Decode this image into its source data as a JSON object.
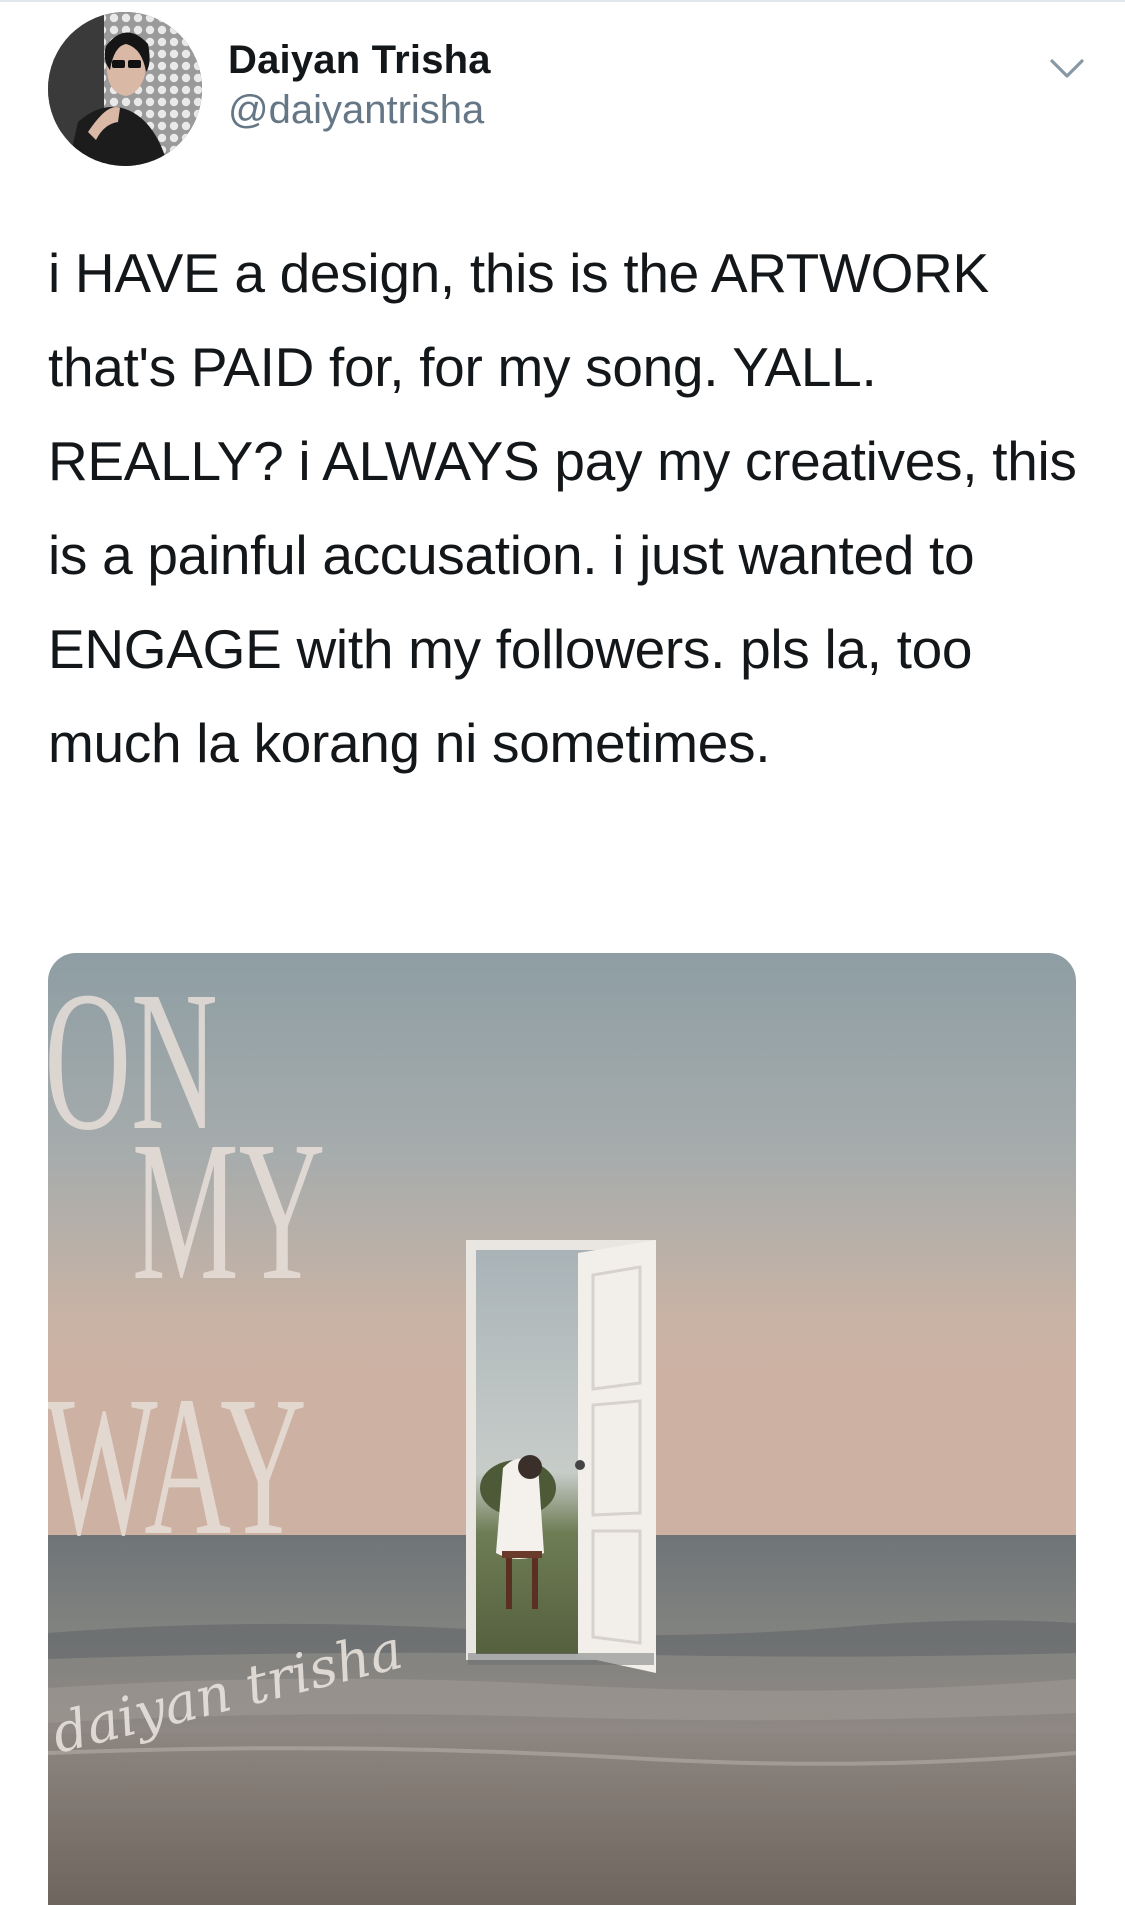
{
  "author": {
    "display_name": "Daiyan Trisha",
    "handle": "@daiyantrisha"
  },
  "tweet": {
    "text": "i HAVE a design, this is the ARTWORK that's PAID for, for my song. YALL. REALLY? i ALWAYS pay my creatives, this is a painful accusation. i just wanted to ENGAGE with my followers. pls la, too much la korang ni sometimes."
  },
  "media": {
    "title_words": [
      "ON",
      "MY",
      "WAY"
    ],
    "signature": "daiyan trisha"
  },
  "icons": {
    "menu": "chevron-down-icon",
    "avatar": "avatar"
  },
  "colors": {
    "text": "#14171a",
    "secondary_text": "#657786",
    "divider": "#e1e8ed"
  }
}
